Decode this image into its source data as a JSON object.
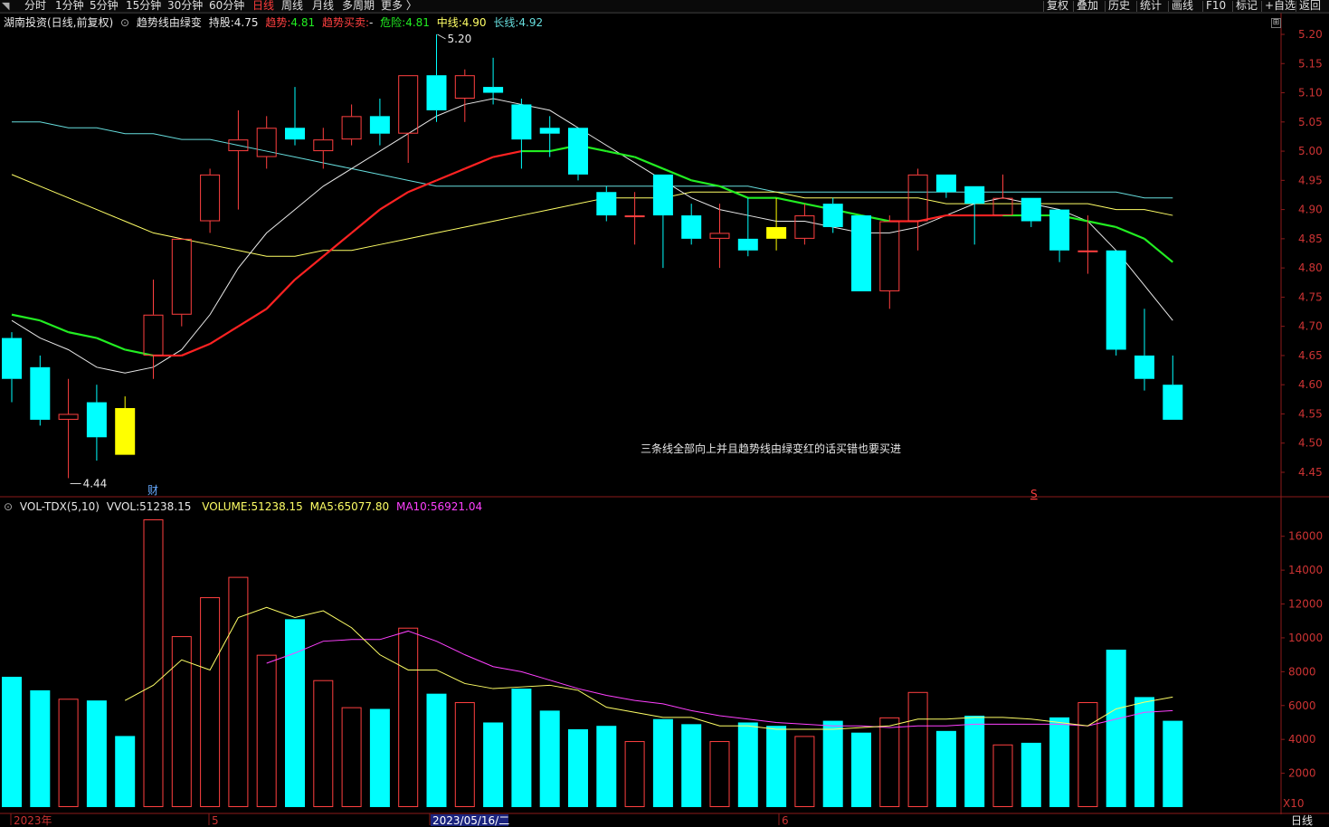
{
  "toolbar": {
    "left_tabs": [
      "分时",
      "1分钟",
      "5分钟",
      "15分钟",
      "30分钟",
      "60分钟",
      "日线",
      "周线",
      "月线",
      "多周期",
      "更多 〉"
    ],
    "active_tab": "日线",
    "right_tabs": [
      "复权",
      "叠加",
      "历史",
      "统计",
      "画线",
      "F10",
      "标记",
      "+自选",
      "返回"
    ]
  },
  "price_panel": {
    "title": "湖南投资(日线,前复权)",
    "indicator_name": "趋势线由绿变",
    "holding_label": "持股:",
    "holding_value": "4.75",
    "trend_label": "趋势:",
    "trend_value": "4.81",
    "buy_sell_label": "趋势买卖:",
    "buy_sell_value": "-",
    "danger_label": "危险:",
    "danger_value": "4.81",
    "mid_label": "中线:",
    "mid_value": "4.90",
    "long_label": "长线:",
    "long_value": "4.92",
    "annotation": "三条线全部向上并且趋势线由绿变红的话买错也要买进",
    "high_label": "5.20",
    "low_label": "4.44",
    "marker_cai": "财",
    "marker_s": "S",
    "y_ticks": [
      "5.20",
      "5.15",
      "5.10",
      "5.05",
      "5.00",
      "4.95",
      "4.90",
      "4.85",
      "4.80",
      "4.75",
      "4.70",
      "4.65",
      "4.60",
      "4.55",
      "4.50",
      "4.45"
    ]
  },
  "volume_panel": {
    "name": "VOL-TDX(5,10)",
    "vvol_label": "VVOL:",
    "vvol_value": "51238.15",
    "volume_label": "VOLUME:",
    "volume_value": "51238.15",
    "ma5_label": "MA5:",
    "ma5_value": "65077.80",
    "ma10_label": "MA10:",
    "ma10_value": "56921.04",
    "y_ticks": [
      "16000",
      "14000",
      "12000",
      "10000",
      "8000",
      "6000",
      "4000",
      "2000"
    ],
    "scale_label": "X10"
  },
  "x_axis": {
    "labels": [
      "2023年",
      "5",
      "2023/05/16/二",
      "6"
    ],
    "period_label": "日线"
  },
  "colors": {
    "up": "#ff4040",
    "down": "#00ffff",
    "highlight": "#ffff00",
    "ma_white": "#e8e8e8",
    "ma_yellow": "#ffff66",
    "ma_cyan": "#66dddd",
    "trend_green": "#22ee22",
    "trend_red": "#ff2222",
    "vol_ma5": "#ffff66",
    "vol_ma10": "#ff40ff"
  },
  "chart_data": {
    "type": "candlestick",
    "candles": [
      {
        "o": 4.68,
        "h": 4.69,
        "l": 4.57,
        "c": 4.61
      },
      {
        "o": 4.63,
        "h": 4.65,
        "l": 4.53,
        "c": 4.54
      },
      {
        "o": 4.54,
        "h": 4.61,
        "l": 4.44,
        "c": 4.55
      },
      {
        "o": 4.57,
        "h": 4.6,
        "l": 4.47,
        "c": 4.51
      },
      {
        "o": 4.48,
        "h": 4.58,
        "l": 4.48,
        "c": 4.56,
        "hl": true
      },
      {
        "o": 4.65,
        "h": 4.78,
        "l": 4.61,
        "c": 4.72
      },
      {
        "o": 4.72,
        "h": 4.85,
        "l": 4.7,
        "c": 4.85
      },
      {
        "o": 4.88,
        "h": 4.97,
        "l": 4.86,
        "c": 4.96
      },
      {
        "o": 5.0,
        "h": 5.07,
        "l": 4.9,
        "c": 5.02
      },
      {
        "o": 4.99,
        "h": 5.06,
        "l": 4.97,
        "c": 5.04
      },
      {
        "o": 5.04,
        "h": 5.11,
        "l": 5.01,
        "c": 5.02
      },
      {
        "o": 5.0,
        "h": 5.04,
        "l": 4.97,
        "c": 5.02
      },
      {
        "o": 5.02,
        "h": 5.08,
        "l": 5.01,
        "c": 5.06
      },
      {
        "o": 5.06,
        "h": 5.09,
        "l": 5.01,
        "c": 5.03
      },
      {
        "o": 5.03,
        "h": 5.13,
        "l": 4.98,
        "c": 5.13
      },
      {
        "o": 5.13,
        "h": 5.2,
        "l": 5.05,
        "c": 5.07
      },
      {
        "o": 5.09,
        "h": 5.14,
        "l": 5.05,
        "c": 5.13
      },
      {
        "o": 5.11,
        "h": 5.16,
        "l": 5.08,
        "c": 5.1
      },
      {
        "o": 5.08,
        "h": 5.09,
        "l": 4.97,
        "c": 5.02
      },
      {
        "o": 5.04,
        "h": 5.06,
        "l": 4.99,
        "c": 5.03
      },
      {
        "o": 5.04,
        "h": 5.04,
        "l": 4.95,
        "c": 4.96
      },
      {
        "o": 4.93,
        "h": 4.94,
        "l": 4.88,
        "c": 4.89
      },
      {
        "o": 4.89,
        "h": 4.93,
        "l": 4.84,
        "c": 4.89
      },
      {
        "o": 4.96,
        "h": 4.96,
        "l": 4.8,
        "c": 4.89
      },
      {
        "o": 4.89,
        "h": 4.91,
        "l": 4.84,
        "c": 4.85
      },
      {
        "o": 4.85,
        "h": 4.91,
        "l": 4.8,
        "c": 4.86
      },
      {
        "o": 4.85,
        "h": 4.92,
        "l": 4.82,
        "c": 4.83
      },
      {
        "o": 4.85,
        "h": 4.92,
        "l": 4.83,
        "c": 4.87,
        "hl": true
      },
      {
        "o": 4.85,
        "h": 4.91,
        "l": 4.84,
        "c": 4.89
      },
      {
        "o": 4.91,
        "h": 4.92,
        "l": 4.86,
        "c": 4.87
      },
      {
        "o": 4.89,
        "h": 4.89,
        "l": 4.76,
        "c": 4.76
      },
      {
        "o": 4.76,
        "h": 4.89,
        "l": 4.73,
        "c": 4.88
      },
      {
        "o": 4.88,
        "h": 4.97,
        "l": 4.83,
        "c": 4.96
      },
      {
        "o": 4.96,
        "h": 4.96,
        "l": 4.92,
        "c": 4.93
      },
      {
        "o": 4.94,
        "h": 4.94,
        "l": 4.84,
        "c": 4.91
      },
      {
        "o": 4.89,
        "h": 4.96,
        "l": 4.89,
        "c": 4.92
      },
      {
        "o": 4.92,
        "h": 4.92,
        "l": 4.87,
        "c": 4.88
      },
      {
        "o": 4.9,
        "h": 4.9,
        "l": 4.81,
        "c": 4.83
      },
      {
        "o": 4.83,
        "h": 4.89,
        "l": 4.79,
        "c": 4.83
      },
      {
        "o": 4.83,
        "h": 4.83,
        "l": 4.65,
        "c": 4.66
      },
      {
        "o": 4.65,
        "h": 4.73,
        "l": 4.59,
        "c": 4.61
      },
      {
        "o": 4.6,
        "h": 4.65,
        "l": 4.54,
        "c": 4.54
      }
    ],
    "volumes": [
      7700,
      6900,
      6400,
      6300,
      4200,
      17000,
      10100,
      12400,
      13600,
      9000,
      11100,
      7500,
      5900,
      5800,
      10600,
      6700,
      6200,
      5000,
      7000,
      5700,
      4600,
      4800,
      3900,
      5200,
      4900,
      3900,
      5000,
      4800,
      4200,
      5100,
      4400,
      5300,
      6800,
      4500,
      5400,
      3700,
      3800,
      5300,
      6200,
      9300,
      6500,
      5100
    ],
    "vol_ma5": [
      null,
      null,
      null,
      null,
      6300,
      7200,
      8700,
      8100,
      11200,
      11800,
      11200,
      11600,
      10600,
      9000,
      8100,
      8100,
      7300,
      7000,
      7100,
      7200,
      6900,
      5900,
      5600,
      5300,
      5300,
      4800,
      4800,
      4600,
      4600,
      4600,
      4700,
      4800,
      5200,
      5200,
      5300,
      5300,
      5200,
      5000,
      4800,
      5800,
      6200,
      6500
    ],
    "vol_ma10": [
      null,
      null,
      null,
      null,
      null,
      null,
      null,
      null,
      null,
      8500,
      9100,
      9800,
      9900,
      9900,
      10400,
      9800,
      9000,
      8300,
      8000,
      7500,
      7000,
      6600,
      6300,
      6100,
      5700,
      5400,
      5200,
      5000,
      4900,
      4800,
      4800,
      4700,
      4800,
      4800,
      4900,
      4900,
      4900,
      4900,
      4800,
      5200,
      5600,
      5700
    ],
    "ma_white": [
      4.71,
      4.68,
      4.66,
      4.63,
      4.62,
      4.63,
      4.66,
      4.72,
      4.8,
      4.86,
      4.9,
      4.94,
      4.97,
      5.0,
      5.03,
      5.06,
      5.08,
      5.09,
      5.08,
      5.07,
      5.04,
      5.01,
      4.98,
      4.95,
      4.92,
      4.9,
      4.89,
      4.88,
      4.88,
      4.87,
      4.86,
      4.86,
      4.87,
      4.89,
      4.91,
      4.92,
      4.91,
      4.9,
      4.88,
      4.83,
      4.77,
      4.71
    ],
    "ma_yellow": [
      4.96,
      4.94,
      4.92,
      4.9,
      4.88,
      4.86,
      4.85,
      4.84,
      4.83,
      4.82,
      4.82,
      4.83,
      4.83,
      4.84,
      4.85,
      4.86,
      4.87,
      4.88,
      4.89,
      4.9,
      4.91,
      4.92,
      4.92,
      4.92,
      4.93,
      4.93,
      4.93,
      4.93,
      4.92,
      4.92,
      4.92,
      4.92,
      4.92,
      4.91,
      4.91,
      4.91,
      4.91,
      4.91,
      4.91,
      4.9,
      4.9,
      4.89
    ],
    "ma_cyan": [
      5.05,
      5.05,
      5.04,
      5.04,
      5.03,
      5.03,
      5.02,
      5.02,
      5.01,
      5.0,
      4.99,
      4.98,
      4.97,
      4.96,
      4.95,
      4.94,
      4.94,
      4.94,
      4.94,
      4.94,
      4.94,
      4.94,
      4.94,
      4.94,
      4.94,
      4.94,
      4.94,
      4.93,
      4.93,
      4.93,
      4.93,
      4.93,
      4.93,
      4.93,
      4.93,
      4.93,
      4.93,
      4.93,
      4.93,
      4.93,
      4.92,
      4.92
    ],
    "trend": [
      4.72,
      4.71,
      4.69,
      4.68,
      4.66,
      4.65,
      4.65,
      4.67,
      4.7,
      4.73,
      4.78,
      4.82,
      4.86,
      4.9,
      4.93,
      4.95,
      4.97,
      4.99,
      5.0,
      5.0,
      5.01,
      5.0,
      4.99,
      4.97,
      4.95,
      4.94,
      4.92,
      4.92,
      4.91,
      4.9,
      4.89,
      4.88,
      4.88,
      4.89,
      4.89,
      4.89,
      4.89,
      4.89,
      4.88,
      4.87,
      4.85,
      4.81
    ],
    "trend_color": [
      "g",
      "g",
      "g",
      "g",
      "g",
      "g",
      "r",
      "r",
      "r",
      "r",
      "r",
      "r",
      "r",
      "r",
      "r",
      "r",
      "r",
      "r",
      "r",
      "g",
      "g",
      "g",
      "g",
      "g",
      "g",
      "g",
      "g",
      "g",
      "g",
      "g",
      "g",
      "g",
      "r",
      "r",
      "r",
      "r",
      "g",
      "g",
      "g",
      "g",
      "g",
      "g"
    ]
  }
}
